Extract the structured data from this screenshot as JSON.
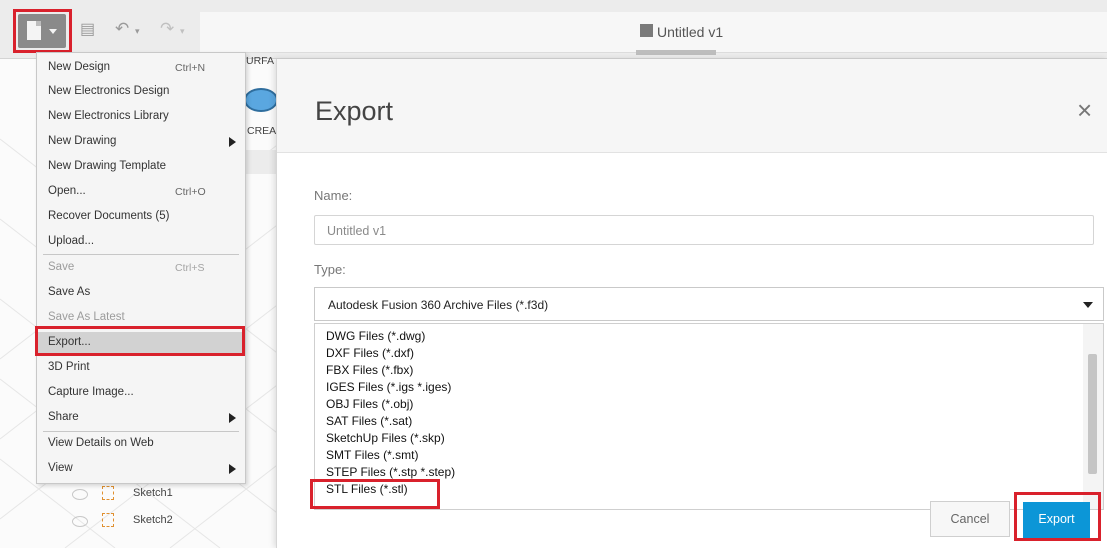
{
  "toolbar": {
    "file_icon": "file-doc-icon",
    "save_icon": "save-icon",
    "undo_icon": "undo-icon",
    "redo_icon": "redo-icon"
  },
  "document_tab": {
    "title": "Untitled v1",
    "icon": "cube-icon"
  },
  "ribbon_partial": {
    "surface_label": "URFA",
    "create_label": "CREA"
  },
  "file_menu": {
    "items": [
      {
        "label": "New Design",
        "shortcut": "Ctrl+N",
        "enabled": true
      },
      {
        "label": "New Electronics Design",
        "shortcut": "",
        "enabled": true
      },
      {
        "label": "New Electronics Library",
        "shortcut": "",
        "enabled": true
      },
      {
        "label": "New Drawing",
        "shortcut": "",
        "enabled": true,
        "submenu": true
      },
      {
        "label": "New Drawing Template",
        "shortcut": "",
        "enabled": true
      },
      {
        "label": "Open...",
        "shortcut": "Ctrl+O",
        "enabled": true
      },
      {
        "label": "Recover Documents (5)",
        "shortcut": "",
        "enabled": true
      },
      {
        "label": "Upload...",
        "shortcut": "",
        "enabled": true
      },
      {
        "label": "Save",
        "shortcut": "Ctrl+S",
        "enabled": false
      },
      {
        "label": "Save As",
        "shortcut": "",
        "enabled": true
      },
      {
        "label": "Save As Latest",
        "shortcut": "",
        "enabled": false
      },
      {
        "label": "Export...",
        "shortcut": "",
        "enabled": true,
        "highlighted": true
      },
      {
        "label": "3D Print",
        "shortcut": "",
        "enabled": true
      },
      {
        "label": "Capture Image...",
        "shortcut": "",
        "enabled": true
      },
      {
        "label": "Share",
        "shortcut": "",
        "enabled": true,
        "submenu": true
      },
      {
        "label": "View Details on Web",
        "shortcut": "",
        "enabled": true
      },
      {
        "label": "View",
        "shortcut": "",
        "enabled": true,
        "submenu": true
      }
    ]
  },
  "browser": {
    "items": [
      "Sketch1",
      "Sketch2"
    ]
  },
  "export_dialog": {
    "title": "Export",
    "close_glyph": "×",
    "name_label": "Name:",
    "name_value": "Untitled v1",
    "type_label": "Type:",
    "type_selected": "Autodesk Fusion 360 Archive Files (*.f3d)",
    "type_options": [
      "DWG Files (*.dwg)",
      "DXF Files (*.dxf)",
      "FBX Files (*.fbx)",
      "IGES Files (*.igs *.iges)",
      "OBJ Files (*.obj)",
      "SAT Files (*.sat)",
      "SketchUp Files (*.skp)",
      "SMT Files (*.smt)",
      "STEP Files (*.stp *.step)",
      "STL Files (*.stl)"
    ],
    "cancel_label": "Cancel",
    "export_label": "Export"
  },
  "colors": {
    "highlight_red": "#d9212c",
    "primary_blue": "#0c96d7"
  }
}
